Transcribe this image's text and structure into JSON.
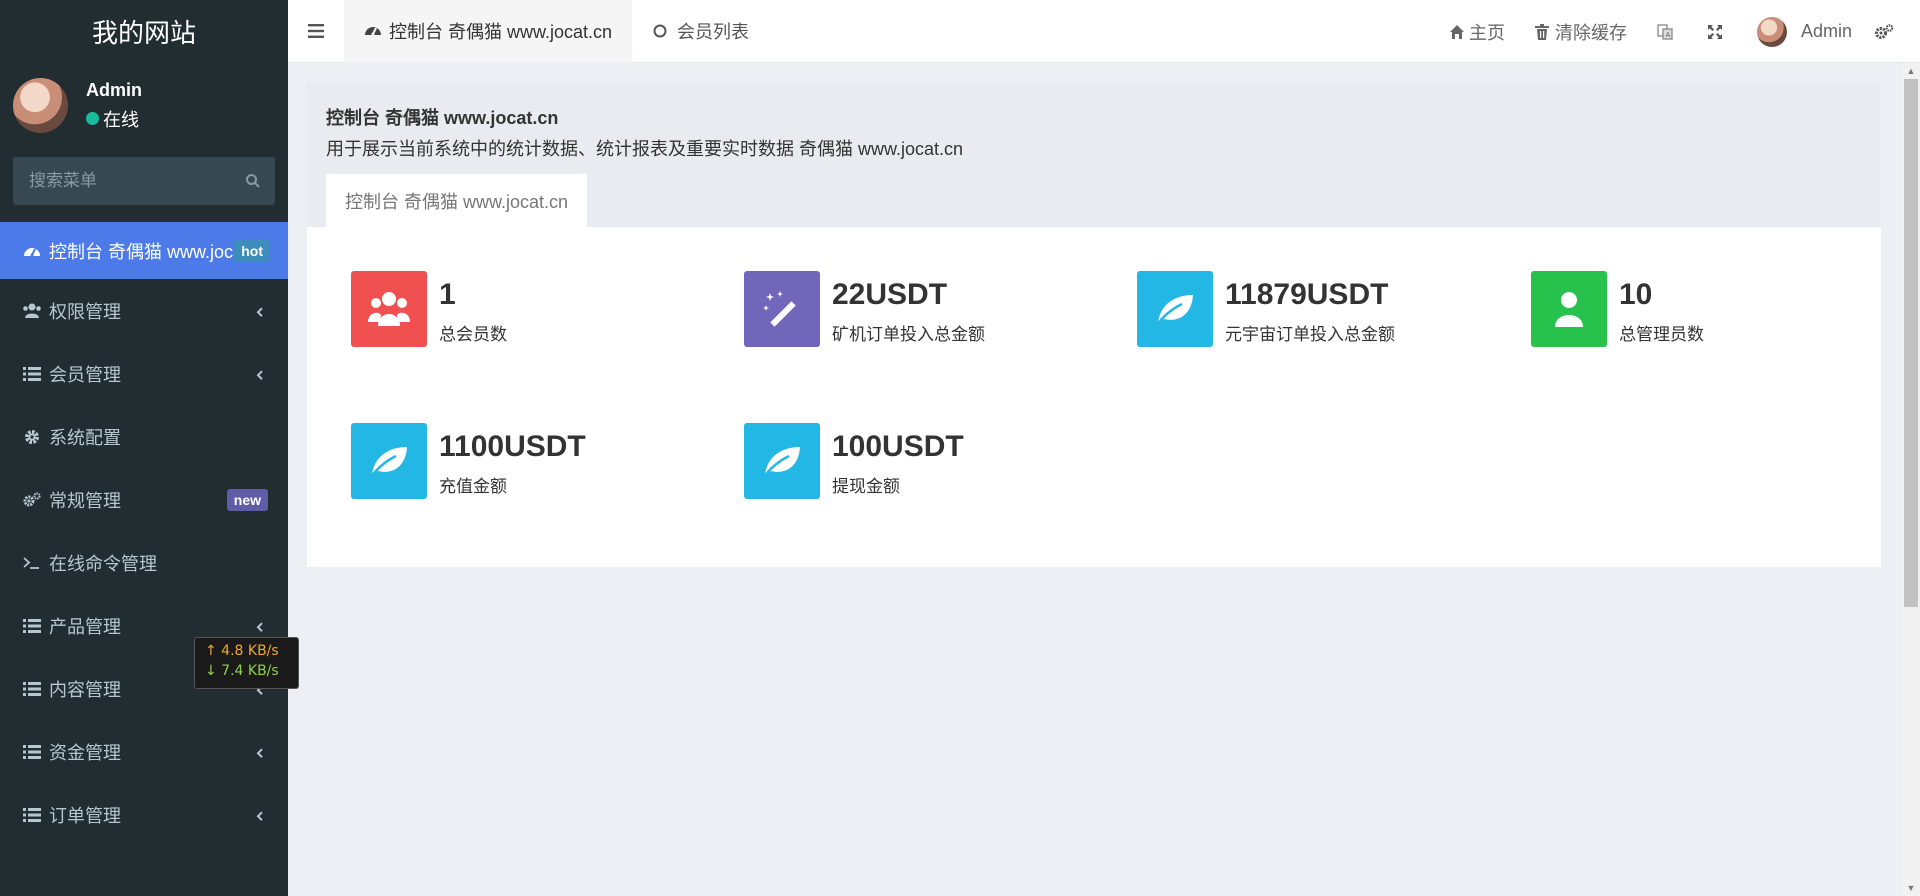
{
  "sidebar": {
    "logo": "我的网站",
    "user": {
      "name": "Admin",
      "status": "在线"
    },
    "search_placeholder": "搜索菜单",
    "items": [
      {
        "label": "控制台 奇偶猫 www.jocat.cn",
        "icon": "dashboard-icon",
        "badge": "hot",
        "active": true
      },
      {
        "label": "权限管理",
        "icon": "users-icon",
        "expandable": true
      },
      {
        "label": "会员管理",
        "icon": "list-icon",
        "expandable": true
      },
      {
        "label": "系统配置",
        "icon": "gear-icon"
      },
      {
        "label": "常规管理",
        "icon": "gears-icon",
        "badge": "new"
      },
      {
        "label": "在线命令管理",
        "icon": "terminal-icon"
      },
      {
        "label": "产品管理",
        "icon": "list-icon",
        "expandable": true
      },
      {
        "label": "内容管理",
        "icon": "list-icon",
        "expandable": true
      },
      {
        "label": "资金管理",
        "icon": "list-icon",
        "expandable": true
      },
      {
        "label": "订单管理",
        "icon": "list-icon",
        "expandable": true
      }
    ]
  },
  "header": {
    "tabs": [
      {
        "label": "控制台 奇偶猫 www.jocat.cn",
        "icon": "dashboard-icon",
        "active": true
      },
      {
        "label": "会员列表",
        "icon": "circle-icon",
        "active": false
      }
    ],
    "home_label": "主页",
    "clear_cache_label": "清除缓存",
    "user_name": "Admin"
  },
  "panel": {
    "title": "控制台 奇偶猫 www.jocat.cn",
    "description": "用于展示当前系统中的统计数据、统计报表及重要实时数据 奇偶猫 www.jocat.cn",
    "tab": "控制台 奇偶猫 www.jocat.cn"
  },
  "stats": [
    {
      "value": "1",
      "label": "总会员数",
      "icon": "users-icon",
      "color": "#f05050"
    },
    {
      "value": "22USDT",
      "label": "矿机订单投入总金额",
      "icon": "magic-wand-icon",
      "color": "#7266ba"
    },
    {
      "value": "11879USDT",
      "label": "元宇宙订单投入总金额",
      "icon": "leaf-icon",
      "color": "#23b7e5"
    },
    {
      "value": "10",
      "label": "总管理员数",
      "icon": "user-icon",
      "color": "#27c24c"
    },
    {
      "value": "1100USDT",
      "label": "充值金额",
      "icon": "leaf-icon",
      "color": "#23b7e5"
    },
    {
      "value": "100USDT",
      "label": "提现金额",
      "icon": "leaf-icon",
      "color": "#23b7e5"
    }
  ],
  "network": {
    "up": "↑ 4.8 KB/s",
    "down": "↓ 7.4 KB/s"
  },
  "colors": {
    "sidebar_bg": "#222d32",
    "active_item": "#4c7ae8",
    "online": "#18bc9c"
  }
}
